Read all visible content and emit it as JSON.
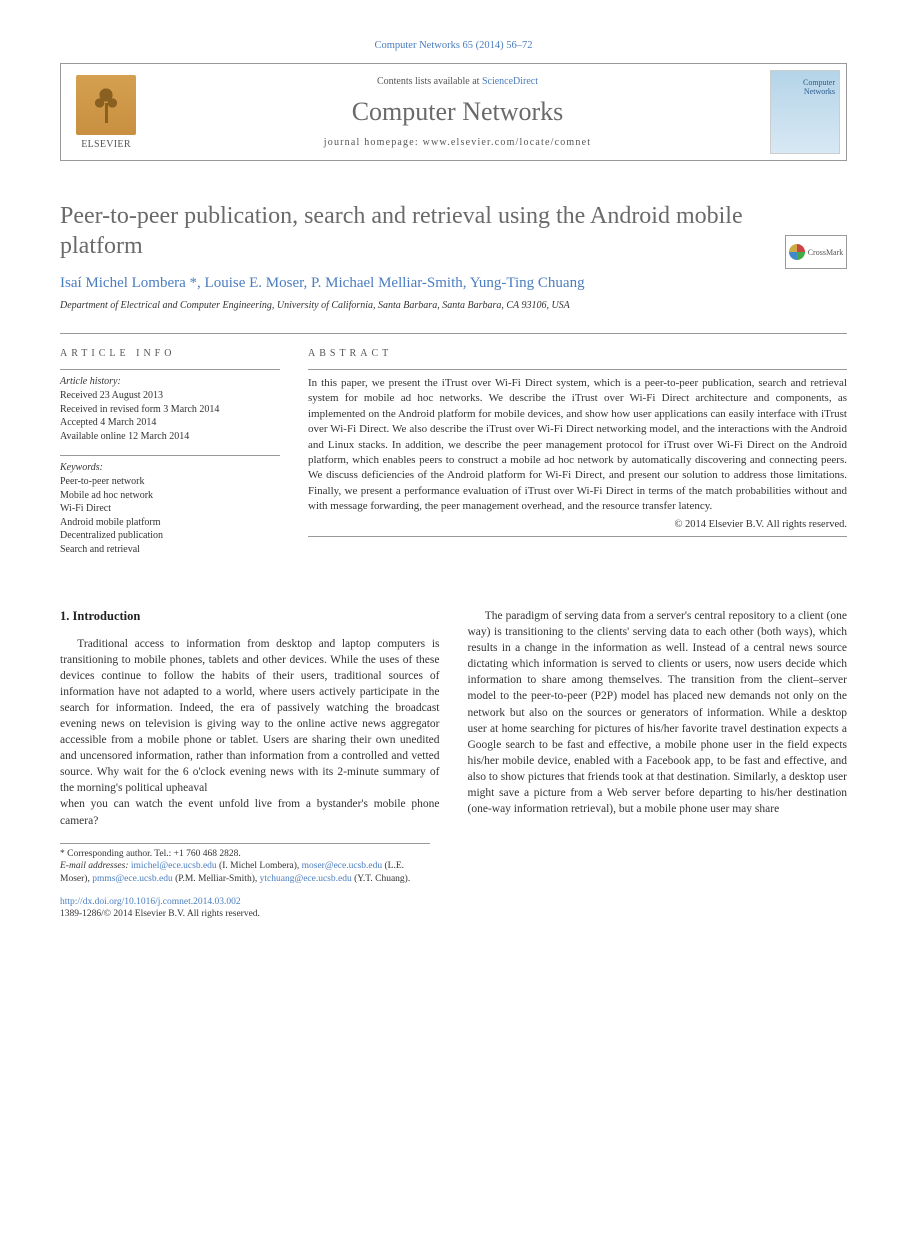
{
  "journal_ref": "Computer Networks 65 (2014) 56–72",
  "header": {
    "publisher": "ELSEVIER",
    "contents_prefix": "Contents lists available at ",
    "contents_link": "ScienceDirect",
    "journal_title": "Computer Networks",
    "homepage_prefix": "journal homepage: ",
    "homepage_url": "www.elsevier.com/locate/comnet",
    "cover_text": "Computer Networks"
  },
  "crossmark_label": "CrossMark",
  "article": {
    "title": "Peer-to-peer publication, search and retrieval using the Android mobile platform",
    "authors_line": "Isaí Michel Lombera *, Louise E. Moser, P. Michael Melliar-Smith, Yung-Ting Chuang",
    "affiliation": "Department of Electrical and Computer Engineering, University of California, Santa Barbara, Santa Barbara, CA 93106, USA"
  },
  "info": {
    "heading": "ARTICLE INFO",
    "history_label": "Article history:",
    "history": [
      "Received 23 August 2013",
      "Received in revised form 3 March 2014",
      "Accepted 4 March 2014",
      "Available online 12 March 2014"
    ],
    "keywords_label": "Keywords:",
    "keywords": [
      "Peer-to-peer network",
      "Mobile ad hoc network",
      "Wi-Fi Direct",
      "Android mobile platform",
      "Decentralized publication",
      "Search and retrieval"
    ]
  },
  "abstract": {
    "heading": "ABSTRACT",
    "text": "In this paper, we present the iTrust over Wi-Fi Direct system, which is a peer-to-peer publication, search and retrieval system for mobile ad hoc networks. We describe the iTrust over Wi-Fi Direct architecture and components, as implemented on the Android platform for mobile devices, and show how user applications can easily interface with iTrust over Wi-Fi Direct. We also describe the iTrust over Wi-Fi Direct networking model, and the interactions with the Android and Linux stacks. In addition, we describe the peer management protocol for iTrust over Wi-Fi Direct on the Android platform, which enables peers to construct a mobile ad hoc network by automatically discovering and connecting peers. We discuss deficiencies of the Android platform for Wi-Fi Direct, and present our solution to address those limitations. Finally, we present a performance evaluation of iTrust over Wi-Fi Direct in terms of the match probabilities without and with message forwarding, the peer management overhead, and the resource transfer latency.",
    "copyright": "© 2014 Elsevier B.V. All rights reserved."
  },
  "body": {
    "section_number": "1.",
    "section_title": "Introduction",
    "para1": "Traditional access to information from desktop and laptop computers is transitioning to mobile phones, tablets and other devices. While the uses of these devices continue to follow the habits of their users, traditional sources of information have not adapted to a world, where users actively participate in the search for information. Indeed, the era of passively watching the broadcast evening news on television is giving way to the online active news aggregator accessible from a mobile phone or tablet. Users are sharing their own unedited and uncensored information, rather than information from a controlled and vetted source. Why wait for the 6 o'clock evening news with its 2-minute summary of the morning's political upheaval",
    "para1b": "when you can watch the event unfold live from a bystander's mobile phone camera?",
    "para2": "The paradigm of serving data from a server's central repository to a client (one way) is transitioning to the clients' serving data to each other (both ways), which results in a change in the information as well. Instead of a central news source dictating which information is served to clients or users, now users decide which information to share among themselves. The transition from the client–server model to the peer-to-peer (P2P) model has placed new demands not only on the network but also on the sources or generators of information. While a desktop user at home searching for pictures of his/her favorite travel destination expects a Google search to be fast and effective, a mobile phone user in the field expects his/her mobile device, enabled with a Facebook app, to be fast and effective, and also to show pictures that friends took at that destination. Similarly, a desktop user might save a picture from a Web server before departing to his/her destination (one-way information retrieval), but a mobile phone user may share"
  },
  "footnotes": {
    "corresponding": "* Corresponding author. Tel.: +1 760 468 2828.",
    "emails_label": "E-mail addresses: ",
    "emails": [
      {
        "addr": "imichel@ece.ucsb.edu",
        "who": "(I. Michel Lombera)"
      },
      {
        "addr": "moser@ece.ucsb.edu",
        "who": "(L.E. Moser)"
      },
      {
        "addr": "pmms@ece.ucsb.edu",
        "who": "(P.M. Melliar-Smith)"
      },
      {
        "addr": "ytchuang@ece.ucsb.edu",
        "who": "(Y.T. Chuang)"
      }
    ]
  },
  "doi": {
    "url": "http://dx.doi.org/10.1016/j.comnet.2014.03.002",
    "issn_line": "1389-1286/© 2014 Elsevier B.V. All rights reserved."
  }
}
